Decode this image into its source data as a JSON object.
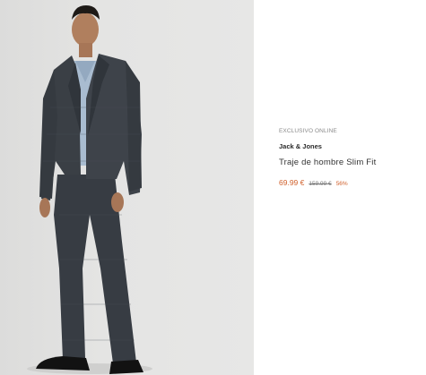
{
  "product": {
    "image_alt": "Traje de hombre Slim Fit",
    "badge": "EXCLUSIVO ONLINE",
    "brand": "Jack & Jones",
    "name": "Traje de hombre Slim Fit",
    "price_current": "69.99 €",
    "price_original": "159.99 €",
    "discount": "56%"
  },
  "colors": {
    "accent": "#d0602b",
    "suit": "#3a3f45",
    "shirt": "#a9bcd0",
    "background": "#e3e3e2"
  }
}
